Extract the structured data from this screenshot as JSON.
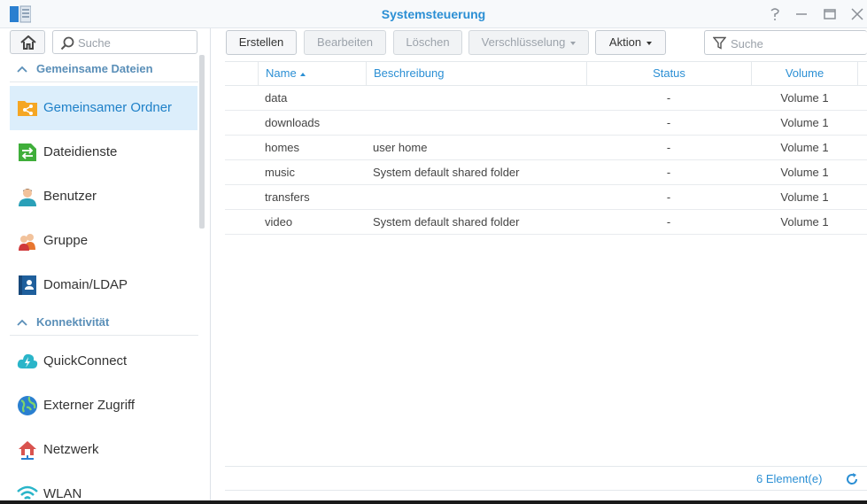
{
  "window": {
    "title": "Systemsteuerung"
  },
  "sidebar": {
    "search_placeholder": "Suche",
    "sections": [
      {
        "label": "Gemeinsame Dateien",
        "items": [
          {
            "label": "Gemeinsamer Ordner",
            "icon": "shared-folder-icon",
            "active": true
          },
          {
            "label": "Dateidienste",
            "icon": "file-services-icon"
          },
          {
            "label": "Benutzer",
            "icon": "user-icon"
          },
          {
            "label": "Gruppe",
            "icon": "group-icon"
          },
          {
            "label": "Domain/LDAP",
            "icon": "domain-ldap-icon"
          }
        ]
      },
      {
        "label": "Konnektivität",
        "items": [
          {
            "label": "QuickConnect",
            "icon": "quickconnect-icon"
          },
          {
            "label": "Externer Zugriff",
            "icon": "external-access-icon"
          },
          {
            "label": "Netzwerk",
            "icon": "network-icon"
          },
          {
            "label": "WLAN",
            "icon": "wifi-icon"
          }
        ]
      }
    ]
  },
  "toolbar": {
    "create": "Erstellen",
    "edit": "Bearbeiten",
    "delete": "Löschen",
    "encryption": "Verschlüsselung",
    "action": "Aktion",
    "search_placeholder": "Suche"
  },
  "table": {
    "columns": [
      "Name",
      "Beschreibung",
      "Status",
      "Volume"
    ],
    "sort_column": "Name",
    "rows": [
      {
        "name": "data",
        "description": "",
        "status": "-",
        "volume": "Volume 1"
      },
      {
        "name": "downloads",
        "description": "",
        "status": "-",
        "volume": "Volume 1"
      },
      {
        "name": "homes",
        "description": "user home",
        "status": "-",
        "volume": "Volume 1"
      },
      {
        "name": "music",
        "description": "System default shared folder",
        "status": "-",
        "volume": "Volume 1"
      },
      {
        "name": "transfers",
        "description": "",
        "status": "-",
        "volume": "Volume 1"
      },
      {
        "name": "video",
        "description": "System default shared folder",
        "status": "-",
        "volume": "Volume 1"
      }
    ]
  },
  "footer": {
    "count": "6 Element(e)"
  },
  "colors": {
    "accent": "#2b8fd4",
    "active_bg": "#dceefb"
  }
}
